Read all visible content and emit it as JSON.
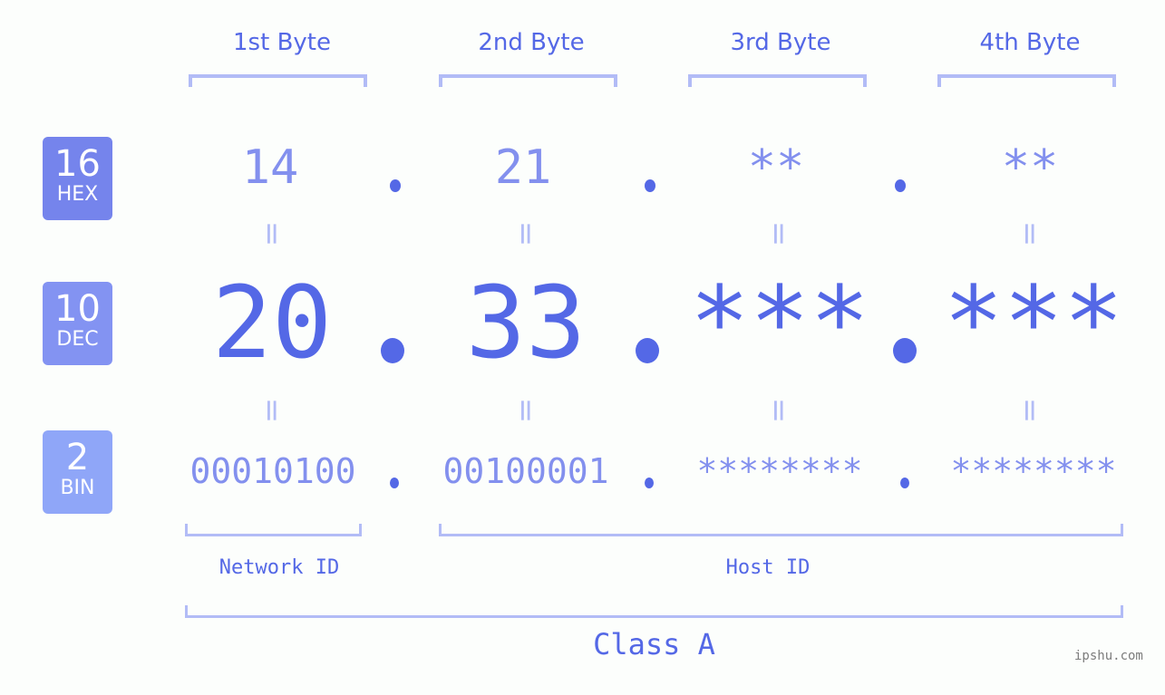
{
  "bytes": [
    {
      "label": "1st Byte",
      "hex": "14",
      "dec": "20",
      "bin": "00010100"
    },
    {
      "label": "2nd Byte",
      "hex": "21",
      "dec": "33",
      "bin": "00100001"
    },
    {
      "label": "3rd Byte",
      "hex": "**",
      "dec": "***",
      "bin": "********"
    },
    {
      "label": "4th Byte",
      "hex": "**",
      "dec": "***",
      "bin": "********"
    }
  ],
  "badges": {
    "hex": {
      "num": "16",
      "label": "HEX",
      "color": "#7584ec"
    },
    "dec": {
      "num": "10",
      "label": "DEC",
      "color": "#8393f2"
    },
    "bin": {
      "num": "2",
      "label": "BIN",
      "color": "#8fa6f8"
    }
  },
  "equals_symbol": "=",
  "sections": {
    "network": "Network ID",
    "host": "Host ID"
  },
  "class_label": "Class A",
  "watermark": "ipshu.com",
  "colors": {
    "accent": "#5468e6",
    "light_accent": "#8390ee",
    "bracket": "#b2bcf6",
    "background": "#fcfefc"
  }
}
